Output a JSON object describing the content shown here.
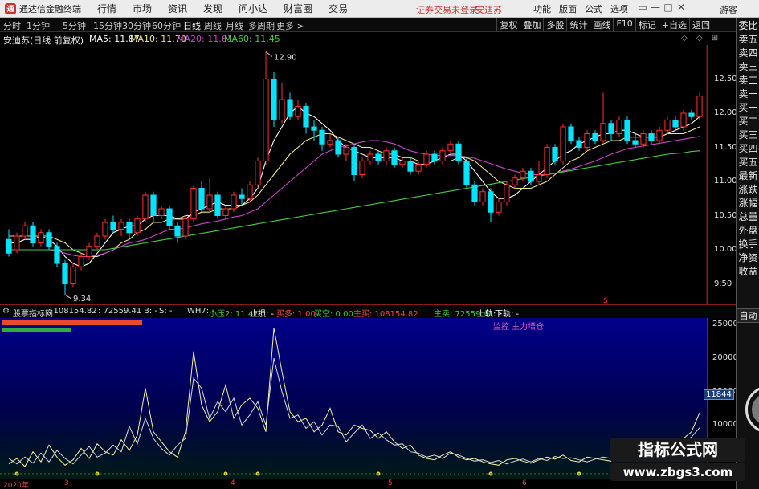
{
  "app": {
    "title": "通达信金融终端",
    "menu": [
      "行情",
      "市场",
      "资讯",
      "发现",
      "问小达",
      "财富圈",
      "交易"
    ],
    "warning": "证券交易未登录",
    "stock_name": "安迪苏",
    "right_menu": [
      "功能",
      "版面",
      "公式",
      "选项"
    ],
    "window_buttons": [
      "▭",
      "—",
      "□",
      "✕"
    ],
    "guest": "游客",
    "logo_letter": "通"
  },
  "period_bar": {
    "items": [
      "分时",
      "1分钟",
      "5分钟",
      "15分钟",
      "30分钟",
      "60分钟",
      "日线",
      "周线",
      "月线",
      "多周期",
      "更多 >"
    ],
    "active": "日线",
    "tools": [
      "复权",
      "叠加",
      "多股",
      "统计",
      "画线",
      "F10",
      "标记",
      "+自选",
      "返回"
    ]
  },
  "info_line": {
    "name": "安迪苏(日线 前复权)",
    "ma5": "MA5: 11.87",
    "ma10": "MA10: 11.70",
    "ma20": "MA20: 11.61",
    "ma60": "MA60: 11.45",
    "corner": "◇ ◇ ⊞"
  },
  "price_axis": {
    "ticks": [
      "12.50",
      "12.00",
      "11.50",
      "11.00",
      "10.50",
      "10.00",
      "9.50"
    ],
    "high_label": "12.90",
    "low_label": "9.34",
    "marker_label": "S"
  },
  "indicator": {
    "header": [
      {
        "text": "股票指标网",
        "color": "#dddddd"
      },
      {
        "text": ": 108154.82",
        "color": "#dddddd"
      },
      {
        "text": ": 72559.41",
        "color": "#dddddd"
      },
      {
        "text": "B: -",
        "color": "#dddddd"
      },
      {
        "text": "S: -",
        "color": "#dddddd"
      },
      {
        "text": "WH7: -",
        "color": "#dddddd"
      },
      {
        "text": "小压2: 11.47",
        "color": "#3fc83f"
      },
      {
        "text": "止损: -",
        "color": "#ffffff"
      },
      {
        "text": "买多: 1.00",
        "color": "#ff4040"
      },
      {
        "text": "买空: 0.00",
        "color": "#3fc83f"
      },
      {
        "text": "主买: 108154.82",
        "color": "#ff4040"
      },
      {
        "text": "主卖: 72559.41",
        "color": "#3fc83f"
      },
      {
        "text": "上轨: -",
        "color": "#ffffff"
      },
      {
        "text": "下轨: -",
        "color": "#ffffff"
      }
    ],
    "monitor_label": "监控 主力增仓",
    "ticks": [
      "25000",
      "20000",
      "15000",
      "10000"
    ],
    "current_value": "11844"
  },
  "time_axis": {
    "labels": [
      "2020年",
      "3",
      "4",
      "5",
      "6"
    ]
  },
  "side_panel": {
    "top_buttons": [
      "委比",
      "卖五",
      "卖四",
      "卖三",
      "卖二",
      "卖一",
      "买一",
      "买二",
      "买三",
      "买四",
      "买五",
      "最新",
      "涨跌",
      "涨幅",
      "总量",
      "外盘",
      "换手",
      "净资",
      "收益"
    ],
    "auto_button": "自动",
    "top_mini": [
      "R",
      "SO"
    ]
  },
  "watermark": {
    "banner": "指标公式网",
    "url": "www.zbgs3.com"
  },
  "colors": {
    "up": "#ff3030",
    "down": "#00e5ff",
    "ma5": "#ffffff",
    "ma10": "#f0e68c",
    "ma20": "#cc44cc",
    "ma60": "#44cc44",
    "indicator_bg": "#00007a"
  },
  "chart_data": {
    "type": "candlestick",
    "y_range": [
      9.2,
      13.0
    ],
    "candles": [
      [
        10.15,
        9.95,
        10.3,
        9.9
      ],
      [
        10.0,
        10.2,
        10.25,
        9.95
      ],
      [
        10.2,
        10.35,
        10.4,
        10.15
      ],
      [
        10.35,
        10.1,
        10.4,
        10.05
      ],
      [
        10.1,
        10.25,
        10.3,
        10.05
      ],
      [
        10.25,
        10.05,
        10.3,
        10.0
      ],
      [
        10.05,
        9.8,
        10.1,
        9.75
      ],
      [
        9.8,
        9.5,
        9.85,
        9.34
      ],
      [
        9.5,
        9.75,
        9.8,
        9.45
      ],
      [
        9.75,
        9.9,
        9.95,
        9.7
      ],
      [
        9.9,
        10.05,
        10.1,
        9.85
      ],
      [
        10.05,
        10.2,
        10.25,
        10.0
      ],
      [
        10.2,
        10.4,
        10.45,
        10.15
      ],
      [
        10.4,
        10.3,
        10.5,
        10.25
      ],
      [
        10.3,
        10.4,
        10.45,
        10.2
      ],
      [
        10.4,
        10.25,
        10.45,
        10.15
      ],
      [
        10.25,
        10.45,
        10.5,
        10.2
      ],
      [
        10.45,
        10.8,
        10.85,
        10.4
      ],
      [
        10.8,
        10.5,
        10.85,
        10.4
      ],
      [
        10.5,
        10.6,
        10.65,
        10.45
      ],
      [
        10.6,
        10.35,
        10.65,
        10.3
      ],
      [
        10.35,
        10.2,
        10.4,
        10.1
      ],
      [
        10.2,
        10.45,
        10.5,
        10.15
      ],
      [
        10.45,
        10.9,
        10.95,
        10.4
      ],
      [
        10.9,
        10.6,
        11.0,
        10.55
      ],
      [
        10.6,
        10.8,
        11.05,
        10.55
      ],
      [
        10.8,
        10.5,
        10.85,
        10.45
      ],
      [
        10.5,
        10.6,
        10.65,
        10.45
      ],
      [
        10.6,
        10.8,
        10.85,
        10.55
      ],
      [
        10.8,
        10.75,
        10.9,
        10.65
      ],
      [
        10.75,
        10.95,
        11.0,
        10.7
      ],
      [
        10.95,
        11.3,
        11.35,
        10.9
      ],
      [
        11.3,
        12.5,
        12.9,
        11.25
      ],
      [
        12.5,
        11.9,
        12.6,
        11.8
      ],
      [
        11.9,
        12.2,
        12.45,
        11.85
      ],
      [
        12.2,
        11.95,
        12.3,
        11.9
      ],
      [
        11.95,
        12.1,
        12.2,
        11.9
      ],
      [
        12.1,
        11.8,
        12.15,
        11.7
      ],
      [
        11.8,
        11.75,
        11.9,
        11.6
      ],
      [
        11.75,
        11.55,
        11.8,
        11.45
      ],
      [
        11.55,
        11.6,
        11.7,
        11.5
      ],
      [
        11.6,
        11.4,
        11.65,
        11.35
      ],
      [
        11.4,
        11.5,
        11.55,
        11.3
      ],
      [
        11.5,
        11.1,
        11.55,
        11.0
      ],
      [
        11.1,
        11.3,
        11.35,
        11.05
      ],
      [
        11.3,
        11.4,
        11.45,
        11.25
      ],
      [
        11.4,
        11.3,
        11.45,
        11.25
      ],
      [
        11.3,
        11.45,
        11.5,
        11.25
      ],
      [
        11.45,
        11.25,
        11.5,
        11.2
      ],
      [
        11.25,
        11.3,
        11.35,
        11.2
      ],
      [
        11.3,
        11.15,
        11.35,
        11.1
      ],
      [
        11.15,
        11.25,
        11.3,
        11.1
      ],
      [
        11.25,
        11.4,
        11.45,
        11.2
      ],
      [
        11.4,
        11.3,
        11.45,
        11.25
      ],
      [
        11.3,
        11.45,
        11.5,
        11.25
      ],
      [
        11.45,
        11.55,
        11.6,
        11.4
      ],
      [
        11.55,
        11.3,
        11.6,
        11.25
      ],
      [
        11.3,
        10.95,
        11.35,
        10.9
      ],
      [
        10.95,
        10.7,
        11.0,
        10.65
      ],
      [
        10.7,
        10.85,
        10.9,
        10.65
      ],
      [
        10.85,
        10.55,
        10.9,
        10.4
      ],
      [
        10.55,
        10.7,
        10.75,
        10.5
      ],
      [
        10.7,
        10.95,
        11.0,
        10.65
      ],
      [
        10.95,
        11.05,
        11.1,
        10.9
      ],
      [
        11.05,
        11.15,
        11.2,
        11.0
      ],
      [
        11.15,
        11.0,
        11.2,
        10.95
      ],
      [
        11.0,
        11.1,
        11.3,
        10.95
      ],
      [
        11.1,
        11.5,
        11.55,
        11.05
      ],
      [
        11.5,
        11.3,
        11.55,
        11.25
      ],
      [
        11.3,
        11.8,
        11.85,
        11.25
      ],
      [
        11.8,
        11.6,
        11.85,
        11.55
      ],
      [
        11.6,
        11.5,
        11.65,
        11.45
      ],
      [
        11.5,
        11.7,
        11.75,
        11.45
      ],
      [
        11.7,
        11.6,
        11.75,
        11.55
      ],
      [
        11.6,
        11.85,
        12.3,
        11.55
      ],
      [
        11.85,
        11.7,
        11.9,
        11.6
      ],
      [
        11.7,
        11.9,
        11.95,
        11.65
      ],
      [
        11.9,
        11.6,
        11.95,
        11.55
      ],
      [
        11.6,
        11.55,
        11.7,
        11.5
      ],
      [
        11.55,
        11.7,
        11.75,
        11.5
      ],
      [
        11.7,
        11.6,
        11.75,
        11.55
      ],
      [
        11.6,
        11.75,
        11.8,
        11.55
      ],
      [
        11.75,
        11.9,
        11.95,
        11.7
      ],
      [
        11.9,
        11.8,
        11.95,
        11.75
      ],
      [
        11.8,
        12.0,
        12.05,
        11.75
      ],
      [
        12.0,
        11.95,
        12.05,
        11.9
      ],
      [
        11.95,
        12.25,
        12.3,
        11.9
      ]
    ],
    "ma_lines": [
      {
        "name": "MA5",
        "points": [
          10.1,
          10.1,
          10.15,
          10.15,
          10.2,
          10.15,
          10.05,
          9.9,
          9.8,
          9.75,
          9.8,
          9.95,
          10.1,
          10.25,
          10.3,
          10.35,
          10.35,
          10.45,
          10.5,
          10.5,
          10.5,
          10.45,
          10.45,
          10.55,
          10.6,
          10.65,
          10.7,
          10.65,
          10.65,
          10.65,
          10.75,
          10.9,
          11.3,
          11.6,
          11.8,
          12.0,
          12.1,
          12.0,
          11.95,
          11.85,
          11.75,
          11.6,
          11.5,
          11.45,
          11.4,
          11.35,
          11.35,
          11.35,
          11.35,
          11.3,
          11.3,
          11.25,
          11.25,
          11.3,
          11.35,
          11.4,
          11.4,
          11.3,
          11.15,
          11.0,
          10.85,
          10.75,
          10.75,
          10.8,
          10.9,
          11.0,
          11.1,
          11.2,
          11.3,
          11.4,
          11.45,
          11.55,
          11.6,
          11.65,
          11.7,
          11.7,
          11.75,
          11.75,
          11.7,
          11.65,
          11.65,
          11.65,
          11.7,
          11.75,
          11.8,
          11.85,
          11.95
        ]
      },
      {
        "name": "MA10",
        "points": [
          10.2,
          10.2,
          10.2,
          10.2,
          10.2,
          10.2,
          10.15,
          10.1,
          10.0,
          9.95,
          9.9,
          9.9,
          9.95,
          10.0,
          10.1,
          10.15,
          10.25,
          10.3,
          10.4,
          10.4,
          10.45,
          10.45,
          10.5,
          10.5,
          10.55,
          10.55,
          10.6,
          10.6,
          10.6,
          10.65,
          10.7,
          10.8,
          10.95,
          11.1,
          11.25,
          11.4,
          11.5,
          11.6,
          11.65,
          11.7,
          11.7,
          11.65,
          11.6,
          11.55,
          11.5,
          11.5,
          11.45,
          11.4,
          11.4,
          11.35,
          11.35,
          11.3,
          11.3,
          11.3,
          11.3,
          11.3,
          11.35,
          11.35,
          11.3,
          11.2,
          11.1,
          11.0,
          10.95,
          10.9,
          10.9,
          10.9,
          10.95,
          11.0,
          11.1,
          11.2,
          11.3,
          11.35,
          11.45,
          11.5,
          11.55,
          11.6,
          11.6,
          11.65,
          11.65,
          11.65,
          11.65,
          11.65,
          11.7,
          11.7,
          11.7,
          11.75,
          11.8
        ]
      },
      {
        "name": "MA20",
        "points": [
          10.0,
          10.0,
          10.0,
          10.0,
          10.0,
          10.0,
          9.98,
          9.95,
          9.92,
          9.9,
          9.9,
          9.92,
          9.95,
          10.0,
          10.05,
          10.1,
          10.12,
          10.15,
          10.2,
          10.25,
          10.3,
          10.3,
          10.32,
          10.35,
          10.38,
          10.4,
          10.42,
          10.45,
          10.48,
          10.5,
          10.55,
          10.6,
          10.7,
          10.8,
          10.9,
          11.0,
          11.1,
          11.2,
          11.3,
          11.4,
          11.45,
          11.5,
          11.52,
          11.55,
          11.58,
          11.6,
          11.6,
          11.58,
          11.55,
          11.5,
          11.45,
          11.42,
          11.4,
          11.38,
          11.38,
          11.38,
          11.38,
          11.36,
          11.34,
          11.3,
          11.26,
          11.22,
          11.18,
          11.15,
          11.12,
          11.1,
          11.1,
          11.1,
          11.12,
          11.15,
          11.18,
          11.22,
          11.26,
          11.3,
          11.35,
          11.4,
          11.44,
          11.48,
          11.5,
          11.52,
          11.54,
          11.56,
          11.58,
          11.6,
          11.62,
          11.64,
          11.66
        ]
      },
      {
        "name": "MA60",
        "points": [
          10.0,
          10.0,
          10.0,
          10.0,
          10.0,
          10.0,
          10.0,
          10.0,
          10.0,
          10.0,
          10.0,
          10.0,
          10.0,
          10.02,
          10.04,
          10.06,
          10.08,
          10.1,
          10.12,
          10.14,
          10.16,
          10.18,
          10.2,
          10.22,
          10.24,
          10.26,
          10.28,
          10.3,
          10.32,
          10.34,
          10.36,
          10.38,
          10.4,
          10.42,
          10.44,
          10.46,
          10.48,
          10.5,
          10.52,
          10.54,
          10.56,
          10.58,
          10.6,
          10.62,
          10.64,
          10.66,
          10.68,
          10.7,
          10.72,
          10.74,
          10.76,
          10.78,
          10.8,
          10.82,
          10.84,
          10.86,
          10.88,
          10.9,
          10.92,
          10.94,
          10.96,
          10.98,
          11.0,
          11.02,
          11.04,
          11.06,
          11.08,
          11.1,
          11.12,
          11.14,
          11.16,
          11.18,
          11.2,
          11.22,
          11.24,
          11.26,
          11.28,
          11.3,
          11.32,
          11.34,
          11.36,
          11.38,
          11.4,
          11.41,
          11.42,
          11.44,
          11.45
        ]
      }
    ],
    "indicator_series": [
      {
        "name": "主买",
        "points": [
          4200,
          5000,
          3800,
          6000,
          4500,
          7000,
          5200,
          4000,
          4800,
          6500,
          5000,
          7200,
          6000,
          5500,
          7800,
          6200,
          8500,
          15500,
          9000,
          7500,
          6000,
          5200,
          9000,
          21000,
          13000,
          10500,
          12000,
          16000,
          11000,
          13000,
          14000,
          12500,
          9000,
          24500,
          18000,
          12000,
          10500,
          11000,
          9000,
          10000,
          12500,
          9000,
          8500,
          10000,
          9500,
          9200,
          8000,
          9000,
          7500,
          6500,
          7000,
          5500,
          5000,
          4800,
          5500,
          6000,
          5200,
          4800,
          5000,
          4500,
          4200,
          4000,
          4800,
          5000,
          4600,
          4300,
          4800,
          5200,
          4900,
          5500,
          4700,
          4500,
          5200,
          5000,
          4800,
          4600,
          5200,
          4700,
          4900,
          5100,
          6000,
          5500,
          7200,
          6500,
          8000,
          9000,
          11844
        ]
      },
      {
        "name": "主卖",
        "points": [
          5000,
          4200,
          5200,
          4300,
          5800,
          4500,
          6200,
          5000,
          4200,
          5500,
          6800,
          5200,
          5800,
          7000,
          6000,
          9800,
          7200,
          11000,
          8000,
          6500,
          5500,
          7000,
          8000,
          17000,
          15500,
          11000,
          13500,
          12000,
          14000,
          10000,
          11500,
          13500,
          10000,
          20000,
          15000,
          11000,
          11500,
          9500,
          10500,
          8500,
          10000,
          9800,
          7500,
          8800,
          10000,
          8000,
          8800,
          7800,
          7000,
          7200,
          6000,
          5800,
          5200,
          5500,
          5000,
          5800,
          5500,
          5000,
          4600,
          4800,
          4400,
          4700,
          4200,
          4600,
          4900,
          4500,
          5000,
          4700,
          5300,
          5000,
          5100,
          4800,
          4500,
          4900,
          5200,
          5000,
          4800,
          5000,
          5400,
          5600,
          5200,
          6400,
          6000,
          7200,
          7400,
          8200,
          9600
        ]
      }
    ],
    "indicator_y_range": [
      2000,
      26000
    ]
  }
}
